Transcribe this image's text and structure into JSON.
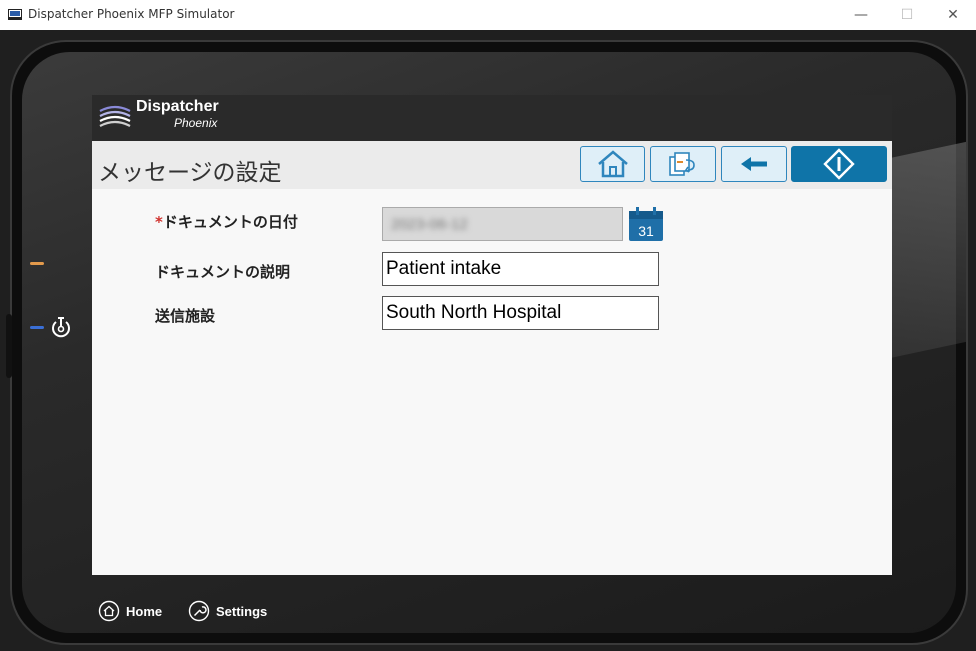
{
  "window": {
    "title": "Dispatcher Phoenix MFP Simulator",
    "minimize": "—",
    "maximize": "☐",
    "close": "✕"
  },
  "brand": {
    "name": "Dispatcher",
    "sub": "Phoenix",
    "bar_color": "#2a2a2a"
  },
  "header": {
    "title": "メッセージの設定",
    "buttons": [
      "home-icon",
      "previous-form-icon",
      "back-arrow-icon",
      "start-icon"
    ],
    "accent_color": "#0f74a8"
  },
  "form": {
    "fields": [
      {
        "label": "ドキュメントの日付",
        "required_marker": "*",
        "value": "2023-06-12",
        "calendar_day": "31"
      },
      {
        "label": "ドキュメントの説明",
        "value": "Patient intake"
      },
      {
        "label": "送信施設",
        "value": "South North Hospital"
      }
    ]
  },
  "device_nav": {
    "home_label": "Home",
    "settings_label": "Settings"
  },
  "indicators": {
    "led_top_color": "#e39a4c",
    "led_bottom_color": "#3a6fd6"
  }
}
